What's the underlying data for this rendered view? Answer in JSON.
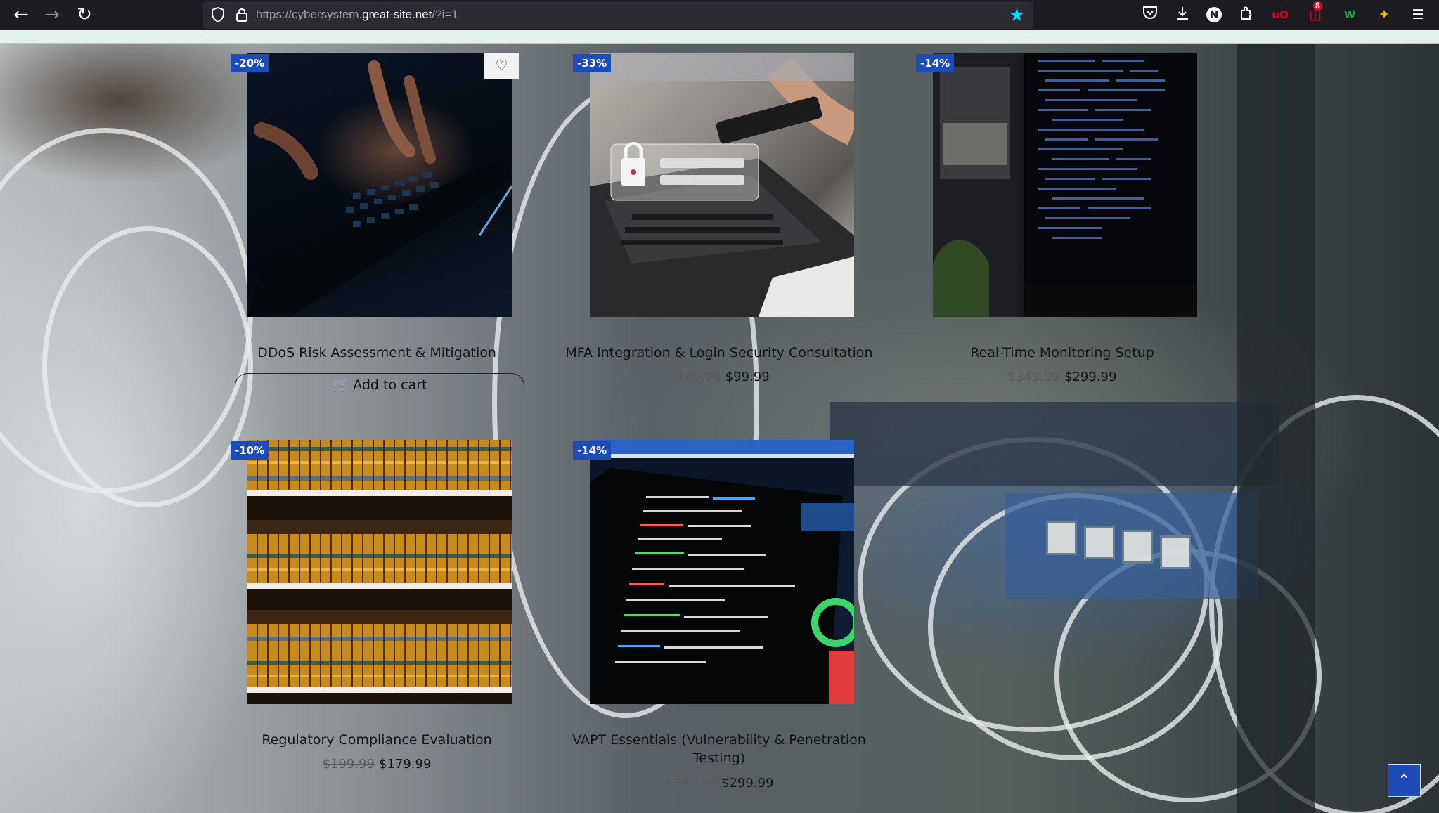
{
  "browser": {
    "url_prefix": "https://cybersystem.",
    "url_domain": "great-site.net",
    "url_suffix": "/?i=1",
    "icons": {
      "back": "arrow-left-icon",
      "forward": "arrow-right-icon",
      "reload": "reload-icon",
      "shield": "shield-icon",
      "lock": "lock-icon",
      "bookmark": "star-icon"
    },
    "extensions": {
      "n_label": "N",
      "ublock_label": "uO",
      "badge_count": "8",
      "w_label": "W"
    }
  },
  "products": [
    {
      "discount": "-20%",
      "title": "DDoS Risk Assessment & Mitigation",
      "cart_label": "Add to cart",
      "wishlist_icon": "heart-icon"
    },
    {
      "discount": "-33%",
      "title": "MFA Integration & Login Security Consultation",
      "old_price": "$149.99",
      "new_price": "$99.99"
    },
    {
      "discount": "-14%",
      "title": "Real-Time Monitoring Setup",
      "old_price": "$349.99",
      "new_price": "$299.99"
    },
    {
      "discount": "-10%",
      "title": "Regulatory Compliance Evaluation",
      "old_price": "$199.99",
      "new_price": "$179.99"
    },
    {
      "discount": "-14%",
      "title": "VAPT Essentials (Vulnerability & Penetration Testing)",
      "old_price": "$349.99",
      "new_price": "$299.99"
    }
  ],
  "scroll_top_icon": "chevron-up-icon",
  "colors": {
    "badge": "#1d4bb8",
    "chrome": "#1c1b22",
    "urlbar": "#2b2a33",
    "bookmark_star": "#00ddff"
  }
}
